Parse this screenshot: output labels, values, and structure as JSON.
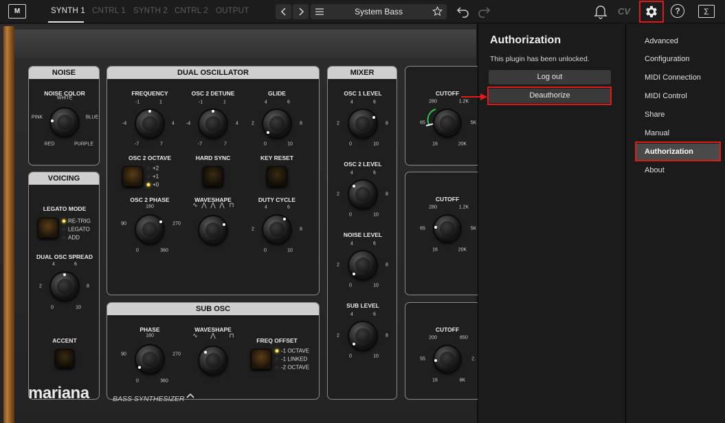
{
  "topbar": {
    "logo": "M",
    "tabs": [
      {
        "label": "SYNTH 1",
        "active": true
      },
      {
        "label": "CNTRL 1",
        "active": false
      },
      {
        "label": "SYNTH 2",
        "active": false
      },
      {
        "label": "CNTRL 2",
        "active": false
      },
      {
        "label": "OUTPUT",
        "active": false
      }
    ],
    "preset_name": "System Bass",
    "cv_label": "CV",
    "help_label": "?",
    "sigma_label": "Σ",
    "icons": {
      "prev": "chevron-left-icon",
      "next": "chevron-right-icon",
      "menu": "menu-icon",
      "favorite": "star-icon",
      "undo": "undo-icon",
      "redo": "redo-icon",
      "bell": "bell-icon",
      "settings": "gear-icon"
    }
  },
  "synth": {
    "brand": "mariana",
    "subtitle": "BASS SYNTHESIZER",
    "noise": {
      "title": "NOISE",
      "color_label": "NOISE COLOR",
      "options": [
        "WHITE",
        "PINK",
        "BLUE",
        "RED",
        "PURPLE"
      ]
    },
    "voicing": {
      "title": "VOICING",
      "legato_label": "LEGATO MODE",
      "legato_options": [
        "RE-TRIG",
        "LEGATO",
        "ADD"
      ],
      "spread_label": "DUAL OSC SPREAD",
      "spread_ticks": [
        "4",
        "6",
        "2",
        "8",
        "0",
        "10"
      ],
      "accent_label": "ACCENT"
    },
    "dual_osc": {
      "title": "DUAL OSCILLATOR",
      "frequency_label": "FREQUENCY",
      "frequency_ticks": [
        "-1",
        "1",
        "-4",
        "4",
        "-7",
        "7"
      ],
      "detune_label": "OSC 2 DETUNE",
      "detune_ticks": [
        "-1",
        "1",
        "-4",
        "4",
        "-7",
        "7"
      ],
      "glide_label": "GLIDE",
      "glide_ticks": [
        "4",
        "6",
        "2",
        "8",
        "0",
        "10"
      ],
      "octave_label": "OSC 2 OCTAVE",
      "octave_options": [
        "+2",
        "+1",
        "+0"
      ],
      "hard_sync_label": "HARD SYNC",
      "key_reset_label": "KEY RESET",
      "phase_label": "OSC 2 PHASE",
      "phase_ticks": [
        "180",
        "90",
        "270",
        "0",
        "360"
      ],
      "waveshape_label": "WAVESHAPE",
      "waveshape_glyphs": [
        "∿",
        "⋀",
        "⋀",
        "⋀",
        "⊓"
      ],
      "duty_label": "DUTY CYCLE",
      "duty_ticks": [
        "4",
        "6",
        "2",
        "8",
        "0",
        "10"
      ]
    },
    "sub_osc": {
      "title": "SUB OSC",
      "phase_label": "PHASE",
      "phase_ticks": [
        "180",
        "90",
        "270",
        "0",
        "360"
      ],
      "waveshape_label": "WAVESHAPE",
      "waveshape_glyphs": [
        "∿",
        "⋀",
        "⊓"
      ],
      "freq_offset_label": "FREQ OFFSET",
      "freq_options": [
        "-1 OCTAVE",
        "-1 LINKED",
        "-2 OCTAVE"
      ]
    },
    "mixer": {
      "title": "MIXER",
      "osc1_label": "OSC 1 LEVEL",
      "osc2_label": "OSC 2 LEVEL",
      "noise_label": "NOISE LEVEL",
      "sub_label": "SUB LEVEL",
      "ticks": [
        "4",
        "6",
        "2",
        "8",
        "0",
        "10"
      ]
    },
    "filter1": {
      "cutoff_label": "CUTOFF",
      "ticks": [
        "280",
        "1.2K",
        "65",
        "5K",
        "16",
        "20K"
      ]
    },
    "filter2": {
      "cutoff_label": "CUTOFF",
      "ticks": [
        "280",
        "1.2K",
        "65",
        "5K",
        "16",
        "20K"
      ]
    },
    "filter3": {
      "cutoff_label": "CUTOFF",
      "ticks": [
        "200",
        "650",
        "55",
        "2.",
        "16",
        "8K"
      ]
    }
  },
  "auth": {
    "title": "Authorization",
    "message": "This plugin has been unlocked.",
    "logout_label": "Log out",
    "deauthorize_label": "Deauthorize"
  },
  "menu": {
    "items": [
      {
        "label": "Advanced",
        "selected": false
      },
      {
        "label": "Configuration",
        "selected": false
      },
      {
        "label": "MIDI Connection",
        "selected": false
      },
      {
        "label": "MIDI Control",
        "selected": false
      },
      {
        "label": "Share",
        "selected": false
      },
      {
        "label": "Manual",
        "selected": false
      },
      {
        "label": "Authorization",
        "selected": true
      },
      {
        "label": "About",
        "selected": false
      }
    ]
  },
  "colors": {
    "highlight": "#e01a1a",
    "led_on": "#ffe76a",
    "panel_header": "#cfcfcf",
    "cutoff_arc": "#2fbf4a"
  }
}
